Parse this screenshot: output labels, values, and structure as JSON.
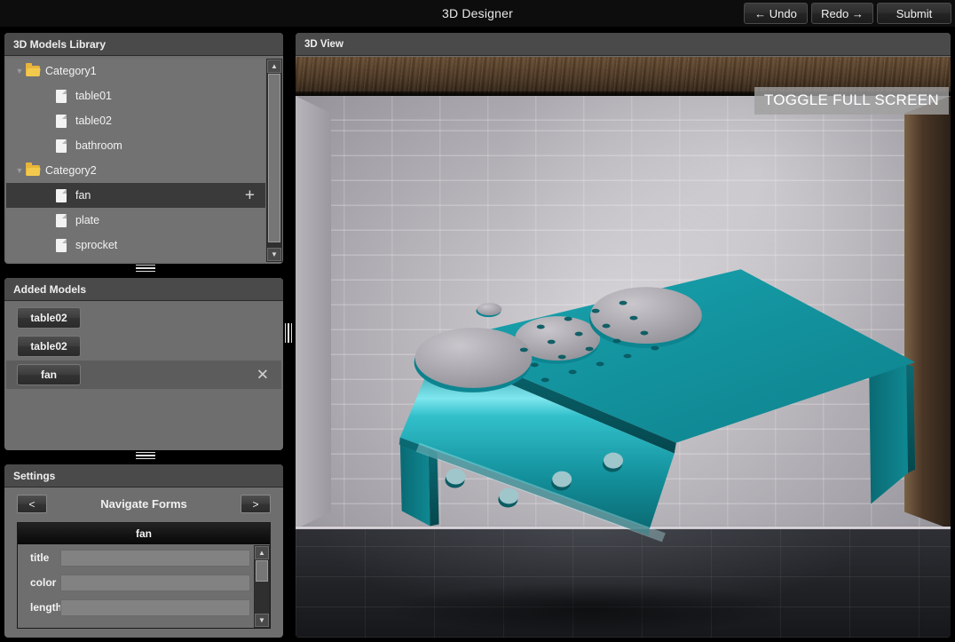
{
  "app": {
    "title": "3D Designer",
    "accent_teal": "#149aa5",
    "panel_bg": "#6e6e6e",
    "header_bg": "#4a4a4a",
    "folder_color": "#f2c94c"
  },
  "toolbar": {
    "undo_label": "← Undo",
    "redo_label": "Redo →",
    "submit_label": "Submit"
  },
  "library": {
    "title": "3D Models Library",
    "nodes": [
      {
        "label": "Category1",
        "type": "folder",
        "depth": 0,
        "caret": "▼",
        "selected": false,
        "plus": false
      },
      {
        "label": "table01",
        "type": "file",
        "depth": 1,
        "caret": "",
        "selected": false,
        "plus": false
      },
      {
        "label": "table02",
        "type": "file",
        "depth": 1,
        "caret": "",
        "selected": false,
        "plus": false
      },
      {
        "label": "bathroom",
        "type": "file",
        "depth": 1,
        "caret": "",
        "selected": false,
        "plus": false
      },
      {
        "label": "Category2",
        "type": "folder",
        "depth": 0,
        "caret": "▼",
        "selected": false,
        "plus": false
      },
      {
        "label": "fan",
        "type": "file",
        "depth": 1,
        "caret": "",
        "selected": true,
        "plus": true
      },
      {
        "label": "plate",
        "type": "file",
        "depth": 1,
        "caret": "",
        "selected": false,
        "plus": false
      },
      {
        "label": "sprocket",
        "type": "file",
        "depth": 1,
        "caret": "",
        "selected": false,
        "plus": false
      }
    ],
    "scroll_up": "▲",
    "scroll_down": "▼"
  },
  "added_models": {
    "title": "Added Models",
    "items": [
      {
        "label": "table02",
        "selected": false,
        "remove": ""
      },
      {
        "label": "table02",
        "selected": false,
        "remove": ""
      },
      {
        "label": "fan",
        "selected": true,
        "remove": "✕"
      }
    ]
  },
  "settings": {
    "title": "Settings",
    "nav_prev": "<",
    "nav_next": ">",
    "nav_title": "Navigate Forms",
    "form_title": "fan",
    "fields": [
      {
        "label": "title",
        "value": "",
        "placeholder": ""
      },
      {
        "label": "color",
        "value": "",
        "placeholder": ""
      },
      {
        "label": "length",
        "value": "",
        "placeholder": ""
      }
    ],
    "scroll_up": "▲",
    "scroll_down": "▼"
  },
  "view": {
    "title": "3D View",
    "fullscreen_label": "TOGGLE FULL SCREEN",
    "scene": "bathroom interior with tiled walls, wooden ceiling and dark tile floor",
    "model_name": "fan",
    "model_color": "#149aa5"
  }
}
